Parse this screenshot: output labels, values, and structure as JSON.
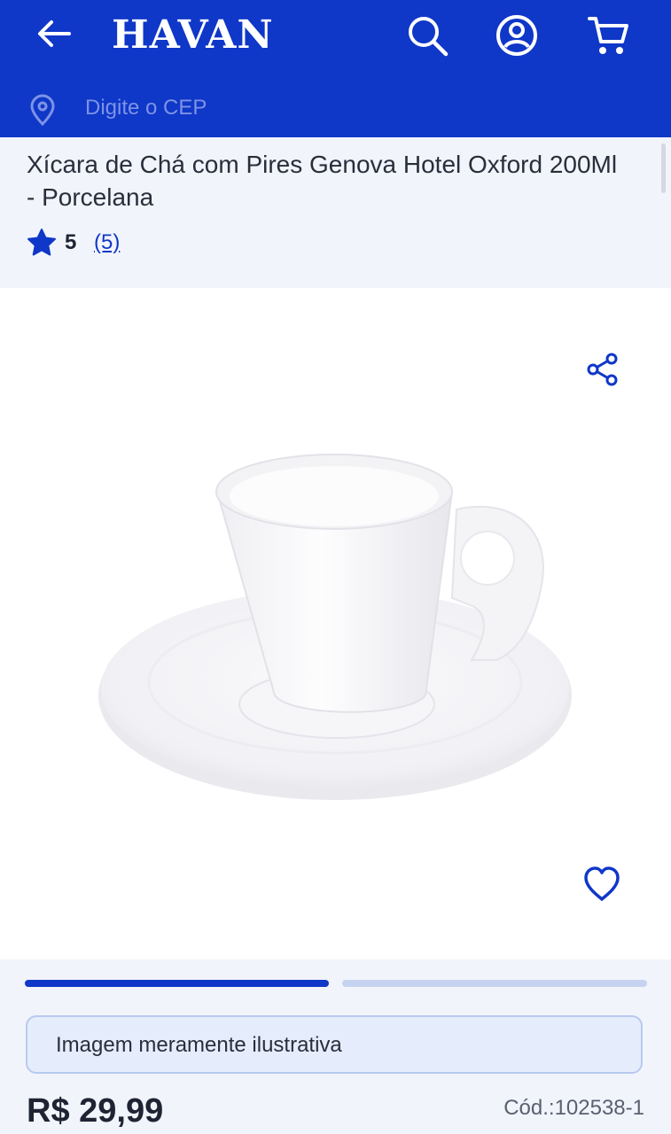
{
  "header": {
    "logo": "HAVAN",
    "cep_placeholder": "Digite o CEP"
  },
  "product": {
    "title": "Xícara de Chá com Pires Genova Hotel Oxford 200Ml - Porcelana",
    "rating": "5",
    "review_count": "(5)",
    "image_notice": "Imagem meramente ilustrativa",
    "price": "R$ 29,99",
    "code": "Cód.:102538-1"
  },
  "gallery": {
    "current_slide": 1,
    "total_slides": 2
  },
  "colors": {
    "brand": "#0f37c8",
    "page_bg": "#f1f4fb"
  },
  "icons": [
    "back-arrow-icon",
    "search-icon",
    "account-icon",
    "cart-icon",
    "location-pin-icon",
    "star-icon",
    "share-icon",
    "heart-icon"
  ]
}
